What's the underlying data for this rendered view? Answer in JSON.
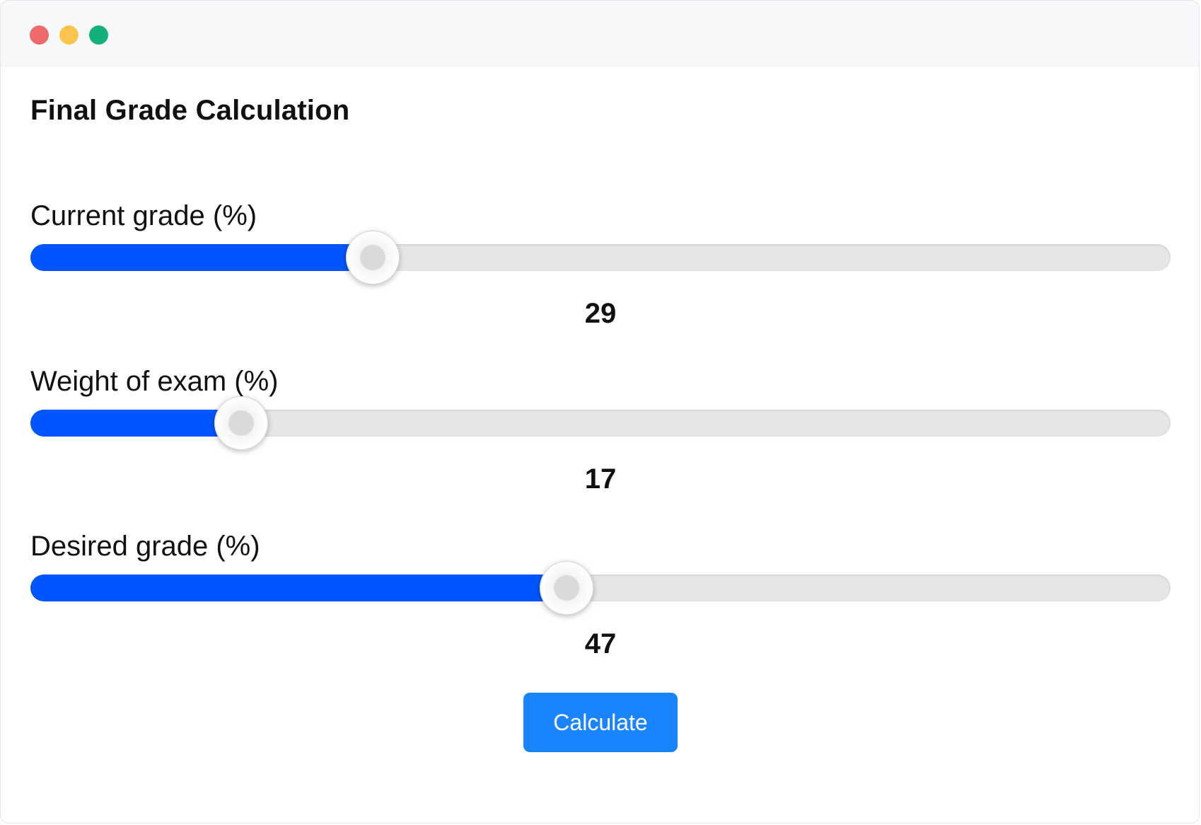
{
  "title": "Final Grade Calculation",
  "colors": {
    "accent": "#0056fe",
    "button": "#1a84fe",
    "track": "#e6e6e6",
    "window_controls": [
      "#ef6a6a",
      "#fdc54f",
      "#14b07c"
    ]
  },
  "sliders": [
    {
      "label": "Current grade (%)",
      "value": "29",
      "fraction": 0.3
    },
    {
      "label": "Weight of exam (%)",
      "value": "17",
      "fraction": 0.185
    },
    {
      "label": "Desired grade (%)",
      "value": "47",
      "fraction": 0.47
    }
  ],
  "calculate_label": "Calculate"
}
